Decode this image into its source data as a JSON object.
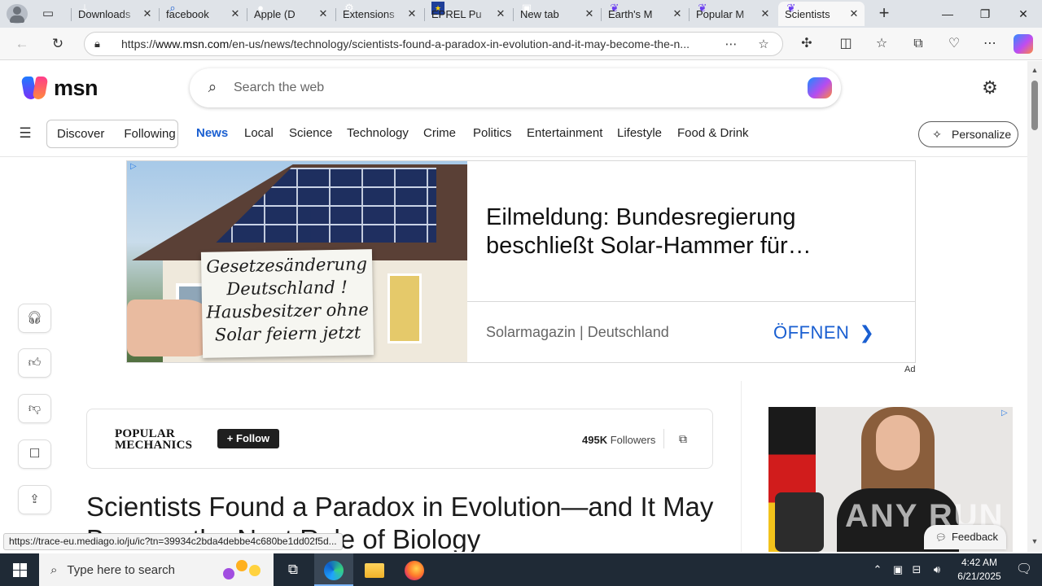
{
  "browser": {
    "tabs": [
      {
        "label": "Downloads",
        "icon": "download-icon"
      },
      {
        "label": "facebook",
        "icon": "search-icon"
      },
      {
        "label": "Apple (D",
        "icon": "apple-icon"
      },
      {
        "label": "Extensions",
        "icon": "extensions-icon"
      },
      {
        "label": "EPREL Pu",
        "icon": "eu-flag-icon"
      },
      {
        "label": "New tab",
        "icon": "newtab-icon"
      },
      {
        "label": "Earth's M",
        "icon": "msn-icon"
      },
      {
        "label": "Popular M",
        "icon": "msn-icon"
      },
      {
        "label": "Scientists",
        "icon": "msn-icon",
        "active": true
      }
    ],
    "url_prefix": "https://",
    "url_host": "www.msn.com",
    "url_path": "/en-us/news/technology/scientists-found-a-paradox-in-evolution-and-it-may-become-the-n..."
  },
  "header": {
    "logo_text": "msn",
    "search_placeholder": "Search the web"
  },
  "nav": {
    "discover": "Discover",
    "following": "Following",
    "links": [
      "News",
      "Local",
      "Science",
      "Technology",
      "Crime",
      "Politics",
      "Entertainment",
      "Lifestyle",
      "Food & Drink"
    ],
    "active": "News",
    "personalize": "Personalize"
  },
  "ad": {
    "card_lines": [
      "Gesetzesänderung",
      "Deutschland !",
      "Hausbesitzer  ohne",
      "Solar feiern jetzt"
    ],
    "headline": "Eilmeldung: Bundesregierung beschließt Solar-Hammer für…",
    "source": "Solarmagazin | Deutschland",
    "cta": "ÖFFNEN",
    "label": "Ad"
  },
  "article": {
    "publisher_logo_lines": [
      "POPULAR",
      "MECHANICS"
    ],
    "follow_label": "Follow",
    "followers_count": "495K",
    "followers_label": "Followers",
    "title": "Scientists Found a Paradox in Evolution—and It May Become the Next Rule of Biology"
  },
  "side_ad": {
    "watermark": "ANY RUN"
  },
  "feedback_label": "Feedback",
  "status_url": "https://trace-eu.mediago.io/ju/ic?tn=39934c2bda4debbe4c680be1dd02f5d...",
  "taskbar": {
    "search_placeholder": "Type here to search",
    "time": "4:42 AM",
    "date": "6/21/2025"
  },
  "colors": {
    "accent_blue": "#1a5fd1",
    "taskbar": "#1f2a36"
  }
}
